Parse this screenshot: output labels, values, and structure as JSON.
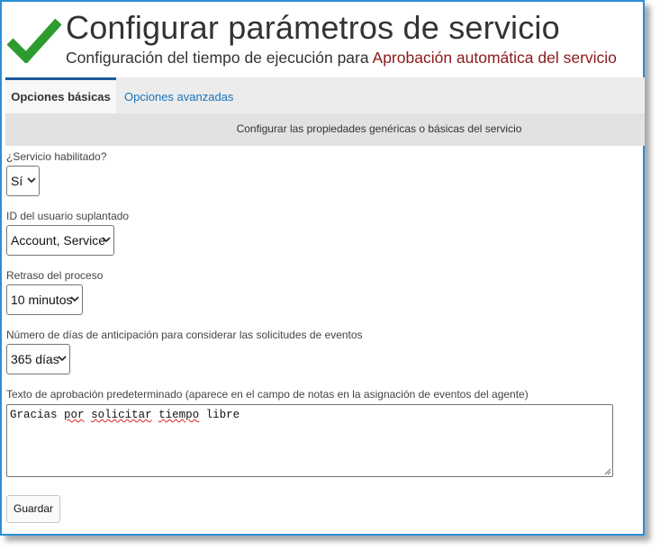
{
  "header": {
    "title": "Configurar parámetros de servicio",
    "subtitle_prefix": "Configuración del tiempo de ejecución para",
    "service_name": "Aprobación automática del servicio",
    "icon": "checkmark-icon",
    "icon_color": "#2e9b2e"
  },
  "tabs": [
    {
      "label": "Opciones básicas",
      "active": true
    },
    {
      "label": "Opciones avanzadas",
      "active": false
    }
  ],
  "banner": "Configurar las propiedades genéricas o básicas del servicio",
  "fields": {
    "service_enabled": {
      "label": "¿Servicio habilitado?",
      "value": "Sí"
    },
    "impersonated_user": {
      "label": "ID del usuario suplantado",
      "value": "Account, Service"
    },
    "process_delay": {
      "label": "Retraso del proceso",
      "value": "10 minutos"
    },
    "lookahead_days": {
      "label": "Número de días de anticipación para considerar las solicitudes de eventos",
      "value": "365 días"
    },
    "default_approval_text": {
      "label": "Texto de aprobación predeterminado (aparece en el campo de notas en la asignación de eventos del agente)",
      "value_words": [
        "Gracias",
        "por",
        "solicitar",
        "tiempo",
        "libre"
      ]
    }
  },
  "save_button": "Guardar",
  "colors": {
    "accent_blue": "#2b8fd6",
    "tab_active_border": "#1e5a9a",
    "link": "#1a73b8",
    "service_name": "#8b1a1a"
  }
}
